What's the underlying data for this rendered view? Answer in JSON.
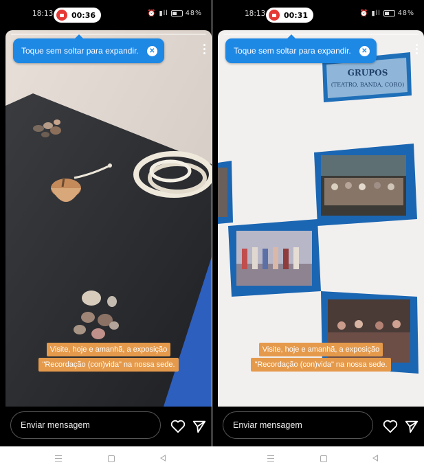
{
  "left": {
    "status": {
      "time": "18:13",
      "rec_time": "00:36",
      "battery": "48%"
    },
    "tooltip": {
      "text": "Toque sem soltar para expandir."
    },
    "caption": {
      "line1": "Visite, hoje e amanhã, a exposição",
      "line2": "\"Recordação (con)vida\" na nossa sede."
    },
    "reply": {
      "placeholder": "Enviar mensagem"
    },
    "progress_fraction": 0.0
  },
  "right": {
    "status": {
      "time": "18:13",
      "rec_time": "00:31",
      "battery": "48%"
    },
    "tooltip": {
      "text": "Toque sem soltar para expandir."
    },
    "caption": {
      "line1": "Visite, hoje e amanhã, a exposição",
      "line2": "\"Recordação (con)vida\" na nossa sede."
    },
    "reply": {
      "placeholder": "Enviar mensagem"
    },
    "sign": {
      "title": "GRUPOS",
      "subtitle": "(TEATRO, BANDA, CORO)"
    },
    "progress_fraction": 0.0
  },
  "colors": {
    "tooltip": "#1e88e5",
    "caption_bg": "#e59a4b",
    "record": "#e53935"
  },
  "icons": [
    "record-icon",
    "close-icon",
    "more-icon",
    "heart-icon",
    "send-icon",
    "menu-icon",
    "home-icon",
    "back-icon"
  ]
}
